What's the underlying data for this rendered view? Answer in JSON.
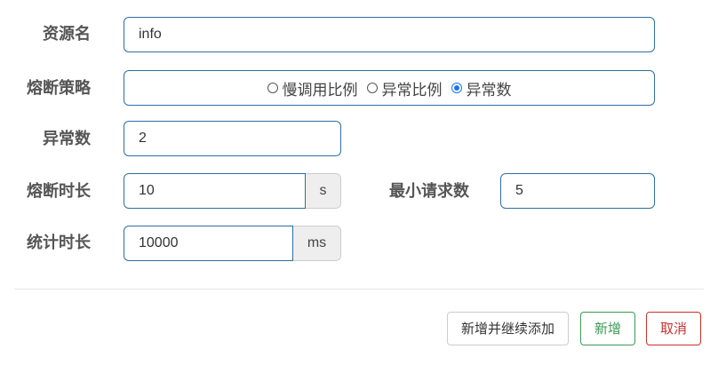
{
  "form": {
    "resource": {
      "label": "资源名",
      "value": "info"
    },
    "strategy": {
      "label": "熔断策略",
      "options": [
        "慢调用比例",
        "异常比例",
        "异常数"
      ],
      "selected": "异常数"
    },
    "exception_count": {
      "label": "异常数",
      "value": "2"
    },
    "break_duration": {
      "label": "熔断时长",
      "value": "10",
      "unit": "s"
    },
    "min_requests": {
      "label": "最小请求数",
      "value": "5"
    },
    "stat_duration": {
      "label": "统计时长",
      "value": "10000",
      "unit": "ms"
    }
  },
  "footer": {
    "add_continue_label": "新增并继续添加",
    "add_label": "新增",
    "cancel_label": "取消"
  },
  "colors": {
    "input_border": "#2f6f9f",
    "success": "#3c9a52",
    "danger": "#c9302c",
    "radio_checked": "#1a73e8"
  }
}
